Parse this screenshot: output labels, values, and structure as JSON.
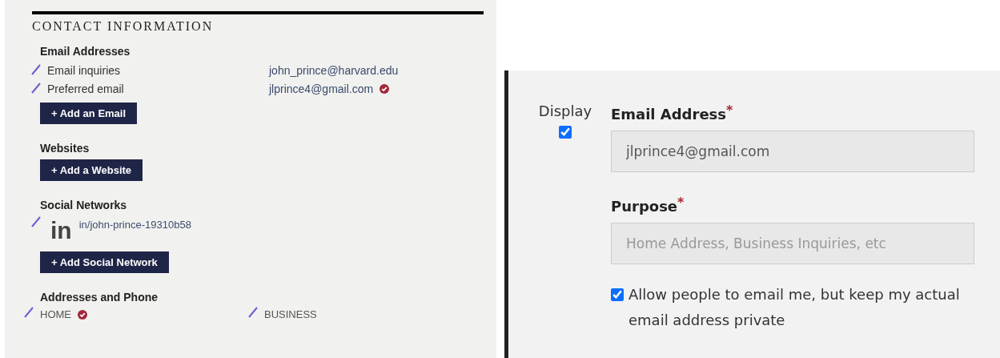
{
  "contact": {
    "title": "CONTACT INFORMATION",
    "sections": [
      {
        "kind": "emails",
        "heading": "Email Addresses",
        "items": [
          {
            "label": "Email inquiries",
            "value": "john_prince@harvard.edu",
            "verified": false
          },
          {
            "label": "Preferred email",
            "value": "jlprince4@gmail.com",
            "verified": true
          }
        ],
        "button": "+ Add an Email"
      },
      {
        "kind": "websites",
        "heading": "Websites",
        "button": "+ Add a Website"
      },
      {
        "kind": "social",
        "heading": "Social Networks",
        "items": [
          {
            "network": "in",
            "value": "in/john-prince-19310b58"
          }
        ],
        "button": "+ Add Social Network"
      },
      {
        "kind": "addresses",
        "heading": "Addresses and Phone",
        "items": [
          {
            "label": "HOME",
            "verified": true
          },
          {
            "label": "BUSINESS",
            "verified": false
          }
        ]
      }
    ]
  },
  "email_form": {
    "display_label": "Display",
    "display_checked": true,
    "fields": [
      {
        "label": "Email Address",
        "required_mark": "*",
        "value": "jlprince4@gmail.com"
      },
      {
        "label": "Purpose",
        "required_mark": "*",
        "placeholder": "Home Address, Business Inquiries, etc"
      }
    ],
    "privacy": {
      "label": "Allow people to email me, but keep my actual email address private",
      "checked": true
    }
  }
}
